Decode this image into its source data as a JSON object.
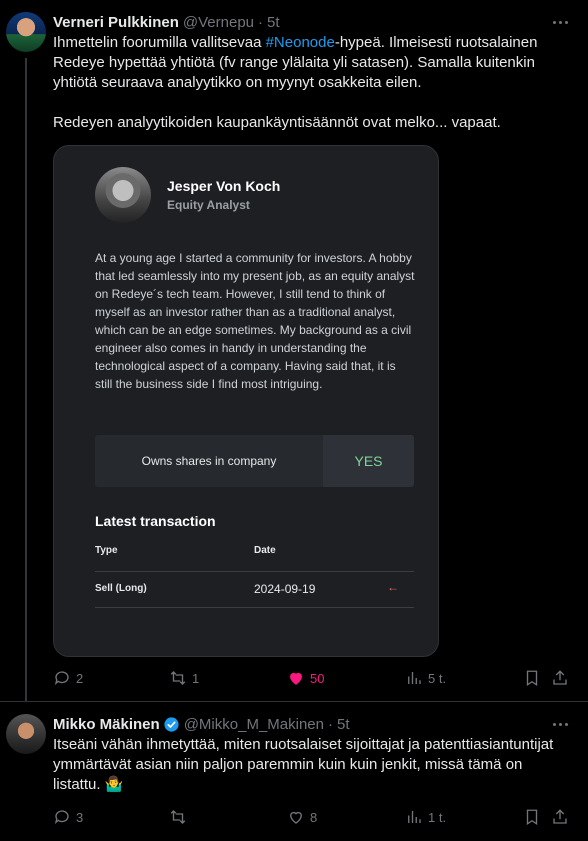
{
  "tweets": [
    {
      "name": "Verneri Pulkkinen",
      "handle": "@Vernepu",
      "time": "5t",
      "text_before_hashtag": "Ihmettelin foorumilla vallitsevaa ",
      "hashtag": "#Neonode",
      "text_after_hashtag": "-hypeä. Ilmeisesti ruotsalainen Redeye hypettää yhtiötä (fv range ylälaita yli satasen). Samalla kuitenkin yhtiötä seuraava analyytikko on myynyt osakkeita eilen.",
      "text_paragraph2": "Redeyen analyytikoiden kaupankäyntisäännöt ovat melko... vapaat.",
      "card": {
        "analyst_name": "Jesper Von Koch",
        "analyst_role": "Equity Analyst",
        "bio": "At a young age I started a community for investors. A hobby that led seamlessly into my present job, as an equity analyst on Redeye´s tech team. However, I still tend to think of myself as an investor rather than as a traditional analyst, which can be an edge sometimes. My background as a civil engineer also comes in handy in understanding the technological aspect of a company. Having said that, it is still the business side I find most intriguing.",
        "owns_label": "Owns shares in company",
        "owns_value": "YES",
        "latest_transaction_title": "Latest transaction",
        "col_type": "Type",
        "col_date": "Date",
        "row_type": "Sell (Long)",
        "row_date": "2024-09-19",
        "row_arrow": "←"
      },
      "actions": {
        "replies": "2",
        "retweets": "1",
        "likes": "50",
        "views": "5 t."
      }
    },
    {
      "name": "Mikko Mäkinen",
      "handle": "@Mikko_M_Makinen",
      "time": "5t",
      "verified": true,
      "text": "Itseäni vähän ihmetyttää, miten ruotsalaiset sijoittajat ja patenttiasiantuntijat ymmärtävät asian niin paljon paremmin kuin kuin jenkit, missä tämä on listattu. 🤷‍♂️",
      "actions": {
        "replies": "3",
        "retweets": "",
        "likes": "8",
        "views": "1 t."
      }
    }
  ],
  "colors": {
    "accent": "#1d9bf0",
    "like": "#f91880",
    "yes_green": "#7ed59a",
    "sell_red": "#e06c6c"
  }
}
